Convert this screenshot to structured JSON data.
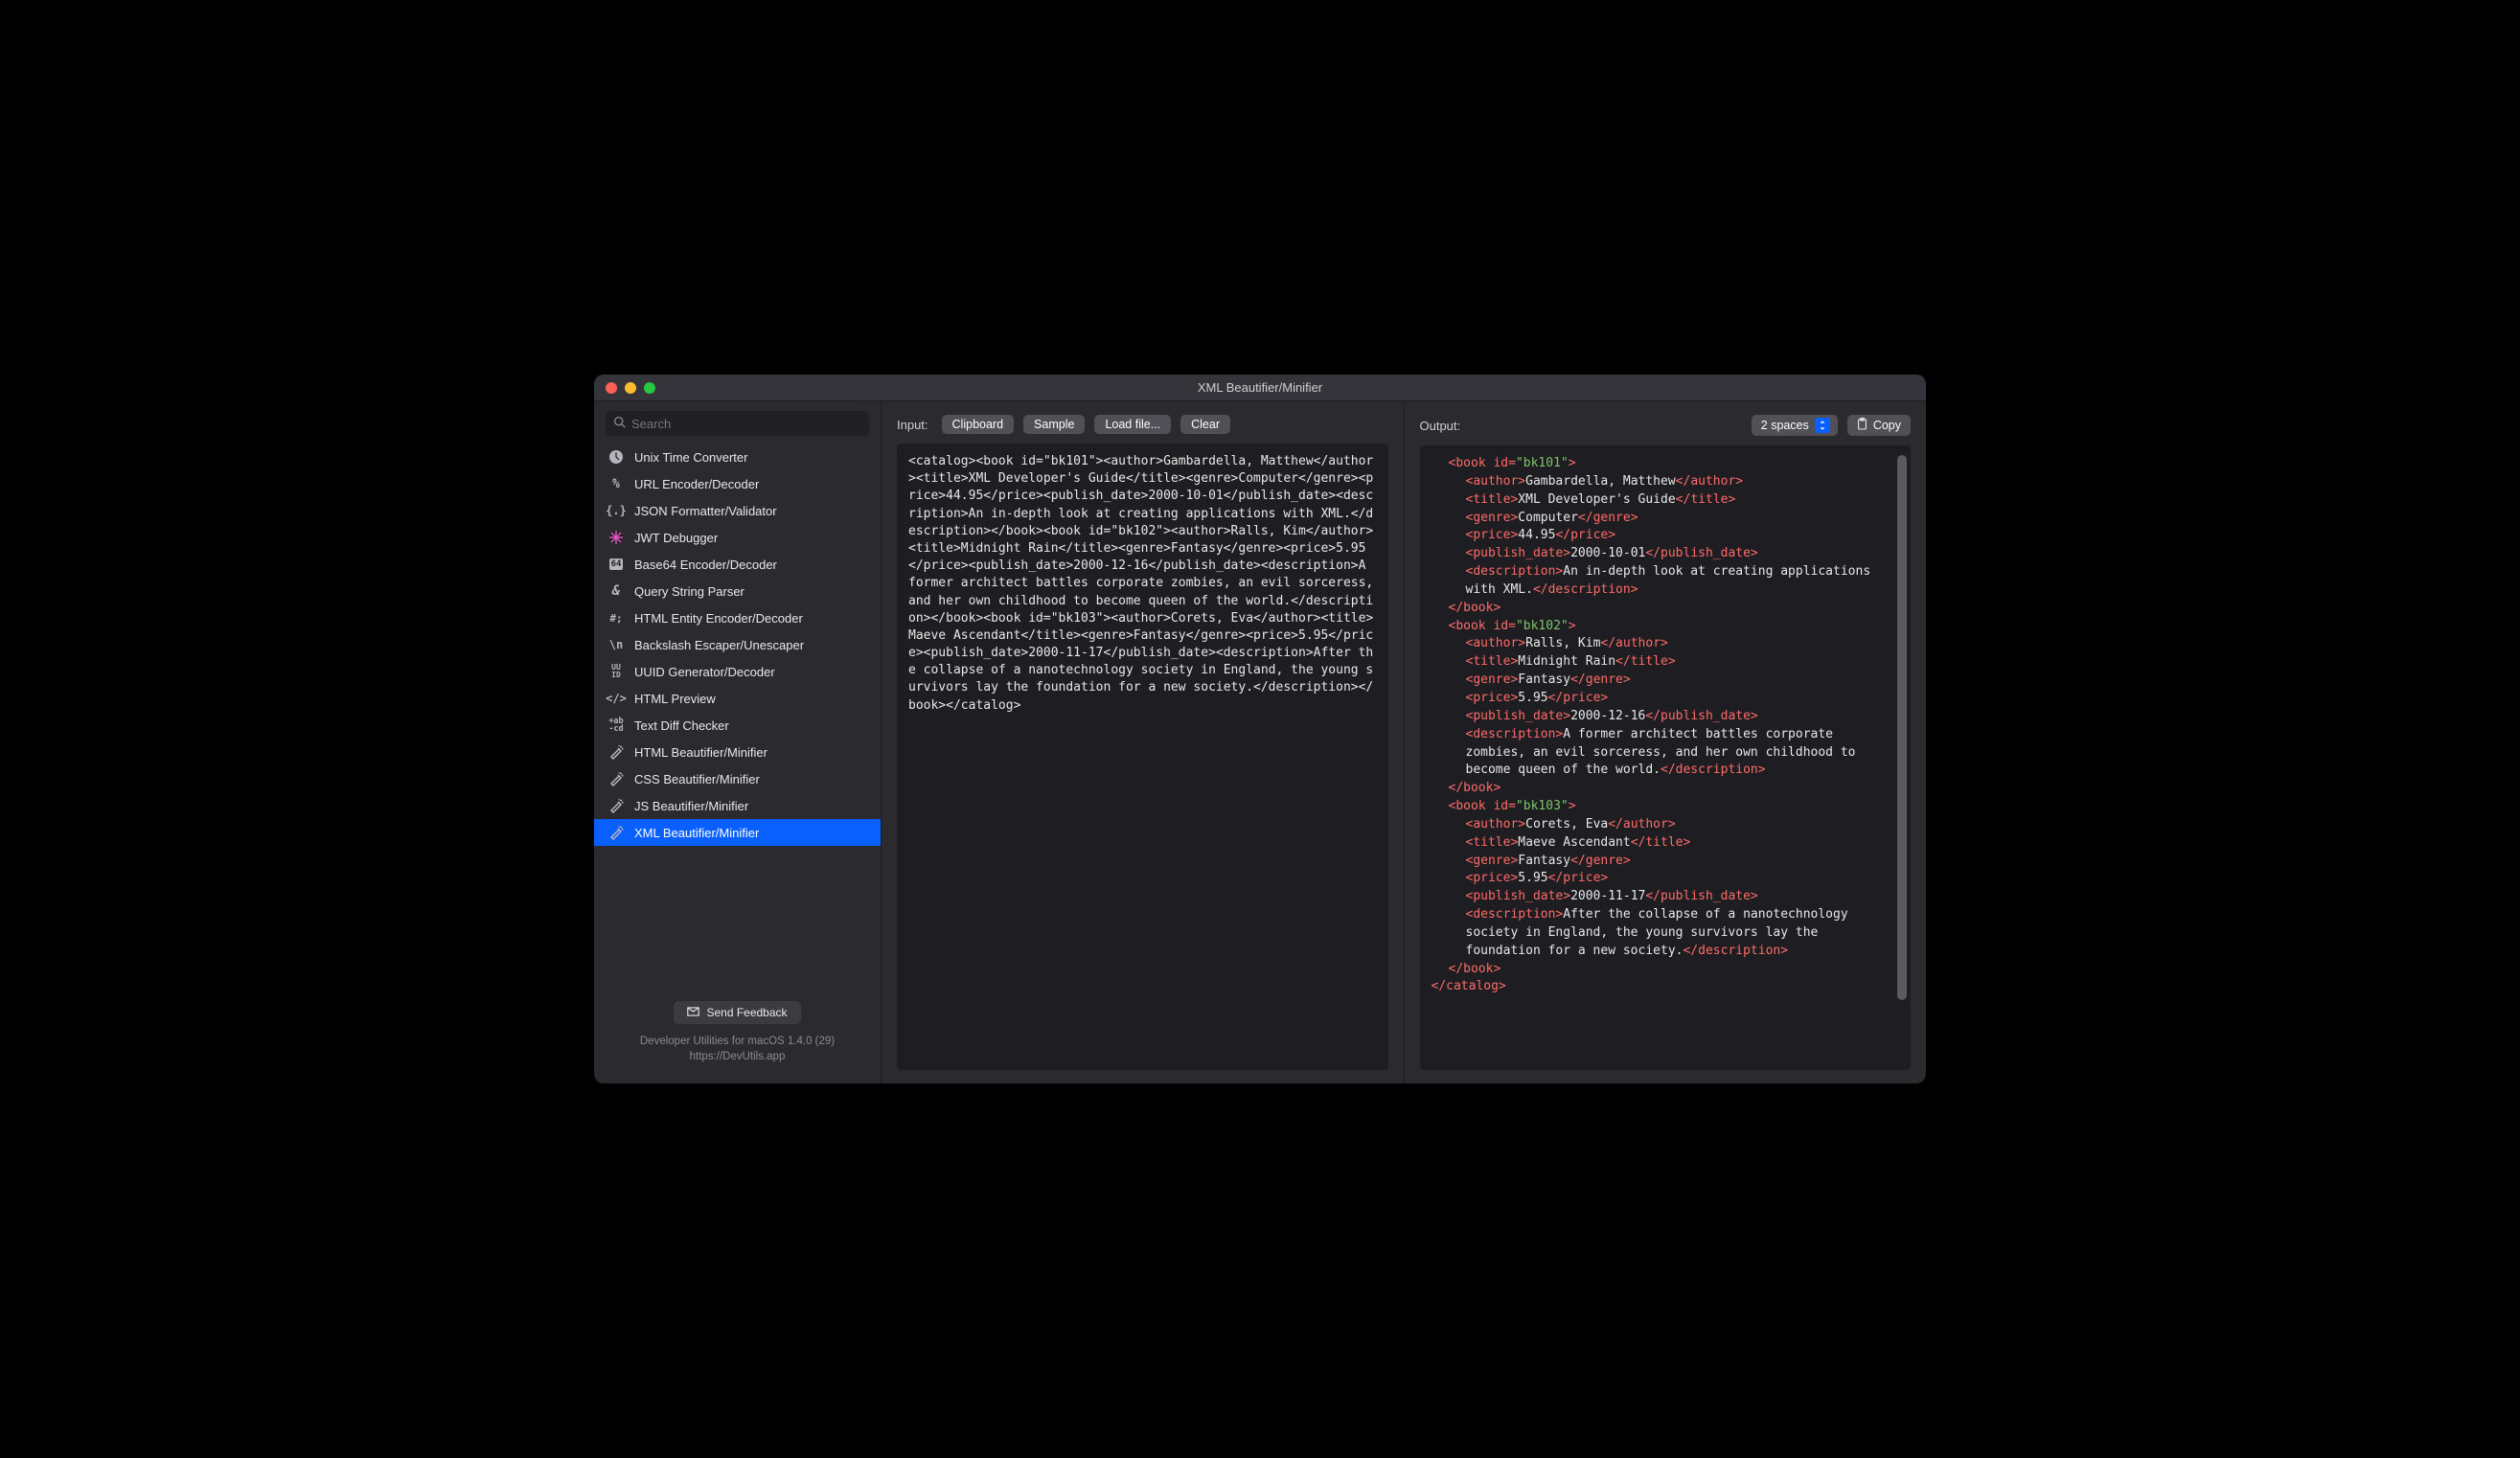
{
  "window": {
    "title": "XML Beautifier/Minifier"
  },
  "sidebar": {
    "search_placeholder": "Search",
    "items": [
      {
        "label": "Unix Time Converter",
        "icon": "clock"
      },
      {
        "label": "URL Encoder/Decoder",
        "icon": "percent"
      },
      {
        "label": "JSON Formatter/Validator",
        "icon": "braces"
      },
      {
        "label": "JWT Debugger",
        "icon": "jwt"
      },
      {
        "label": "Base64 Encoder/Decoder",
        "icon": "b64"
      },
      {
        "label": "Query String Parser",
        "icon": "amp"
      },
      {
        "label": "HTML Entity Encoder/Decoder",
        "icon": "entity"
      },
      {
        "label": "Backslash Escaper/Unescaper",
        "icon": "backslash"
      },
      {
        "label": "UUID Generator/Decoder",
        "icon": "uuid"
      },
      {
        "label": "HTML Preview",
        "icon": "anglebr"
      },
      {
        "label": "Text Diff Checker",
        "icon": "diff"
      },
      {
        "label": "HTML Beautifier/Minifier",
        "icon": "wand"
      },
      {
        "label": "CSS Beautifier/Minifier",
        "icon": "wand"
      },
      {
        "label": "JS Beautifier/Minifier",
        "icon": "wand"
      },
      {
        "label": "XML Beautifier/Minifier",
        "icon": "wand"
      }
    ],
    "selected_index": 14,
    "feedback_label": "Send Feedback",
    "footer_line1": "Developer Utilities for macOS 1.4.0 (29)",
    "footer_line2": "https://DevUtils.app"
  },
  "input": {
    "label": "Input:",
    "buttons": {
      "clipboard": "Clipboard",
      "sample": "Sample",
      "load": "Load file...",
      "clear": "Clear"
    },
    "text": "<catalog><book id=\"bk101\"><author>Gambardella, Matthew</author><title>XML Developer's Guide</title><genre>Computer</genre><price>44.95</price><publish_date>2000-10-01</publish_date><description>An in-depth look at creating applications with XML.</description></book><book id=\"bk102\"><author>Ralls, Kim</author><title>Midnight Rain</title><genre>Fantasy</genre><price>5.95</price><publish_date>2000-12-16</publish_date><description>A former architect battles corporate zombies, an evil sorceress, and her own childhood to become queen of the world.</description></book><book id=\"bk103\"><author>Corets, Eva</author><title>Maeve Ascendant</title><genre>Fantasy</genre><price>5.95</price><publish_date>2000-11-17</publish_date><description>After the collapse of a nanotechnology society in England, the young survivors lay the foundation for a new society.</description></book></catalog>"
  },
  "output": {
    "label": "Output:",
    "indent_selected": "2 spaces",
    "copy_label": "Copy",
    "books": [
      {
        "id": "bk101",
        "author": "Gambardella, Matthew",
        "title": "XML Developer's Guide",
        "genre": "Computer",
        "price": "44.95",
        "publish_date": "2000-10-01",
        "description": "An in-depth look at creating applications with XML."
      },
      {
        "id": "bk102",
        "author": "Ralls, Kim",
        "title": "Midnight Rain",
        "genre": "Fantasy",
        "price": "5.95",
        "publish_date": "2000-12-16",
        "description": "A former architect battles corporate zombies, an evil sorceress, and her own childhood to become queen of the world."
      },
      {
        "id": "bk103",
        "author": "Corets, Eva",
        "title": "Maeve Ascendant",
        "genre": "Fantasy",
        "price": "5.95",
        "publish_date": "2000-11-17",
        "description": "After the collapse of a nanotechnology society in England, the young survivors lay the foundation for a new society."
      }
    ]
  }
}
